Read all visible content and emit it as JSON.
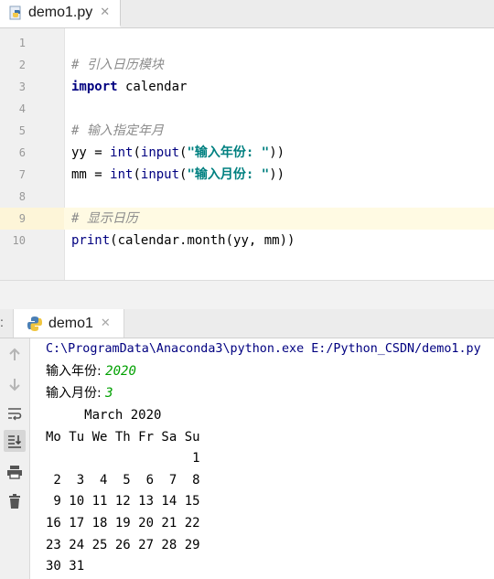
{
  "editor": {
    "tab": {
      "filename": "demo1.py"
    },
    "lines": [
      {
        "number": "1",
        "parts": []
      },
      {
        "number": "2",
        "parts": [
          {
            "text": "# 引入日历模块",
            "style": "cm"
          }
        ]
      },
      {
        "number": "3",
        "parts": [
          {
            "text": "import",
            "style": "kw"
          },
          {
            "text": " calendar",
            "style": ""
          }
        ]
      },
      {
        "number": "4",
        "parts": []
      },
      {
        "number": "5",
        "parts": [
          {
            "text": "# 输入指定年月",
            "style": "cm"
          }
        ]
      },
      {
        "number": "6",
        "parts": [
          {
            "text": "yy = ",
            "style": ""
          },
          {
            "text": "int",
            "style": "bi"
          },
          {
            "text": "(",
            "style": ""
          },
          {
            "text": "input",
            "style": "bi"
          },
          {
            "text": "(",
            "style": ""
          },
          {
            "text": "\"输入年份: \"",
            "style": "str"
          },
          {
            "text": "))",
            "style": ""
          }
        ]
      },
      {
        "number": "7",
        "parts": [
          {
            "text": "mm = ",
            "style": ""
          },
          {
            "text": "int",
            "style": "bi"
          },
          {
            "text": "(",
            "style": ""
          },
          {
            "text": "input",
            "style": "bi"
          },
          {
            "text": "(",
            "style": ""
          },
          {
            "text": "\"输入月份: \"",
            "style": "str"
          },
          {
            "text": "))",
            "style": ""
          }
        ]
      },
      {
        "number": "8",
        "parts": []
      },
      {
        "number": "9",
        "parts": [
          {
            "text": "# 显示日历",
            "style": "cm"
          }
        ]
      },
      {
        "number": "10",
        "parts": [
          {
            "text": "print",
            "style": "bi"
          },
          {
            "text": "(calendar.month(yy, mm))",
            "style": ""
          }
        ]
      }
    ],
    "current_line": "9"
  },
  "run": {
    "tab_label": "demo1",
    "colon": ":",
    "command": "C:\\ProgramData\\Anaconda3\\python.exe E:/Python_CSDN/demo1.py",
    "prompt_year": "输入年份: ",
    "input_year": "2020",
    "prompt_month": "输入月份: ",
    "input_month": "3",
    "calendar_lines": [
      "     March 2020",
      "Mo Tu We Th Fr Sa Su",
      "                   1",
      " 2  3  4  5  6  7  8",
      " 9 10 11 12 13 14 15",
      "16 17 18 19 20 21 22",
      "23 24 25 26 27 28 29",
      "30 31"
    ]
  },
  "toolbar_icons": [
    "arrow-up-icon",
    "arrow-down-icon",
    "soft-wrap-icon",
    "scroll-to-end-icon",
    "print-icon",
    "trash-icon"
  ],
  "colors": {
    "keyword": "#000080",
    "string": "#008080",
    "comment": "#8c8c8c",
    "input": "#00a000",
    "current_line": "#fffae3"
  }
}
